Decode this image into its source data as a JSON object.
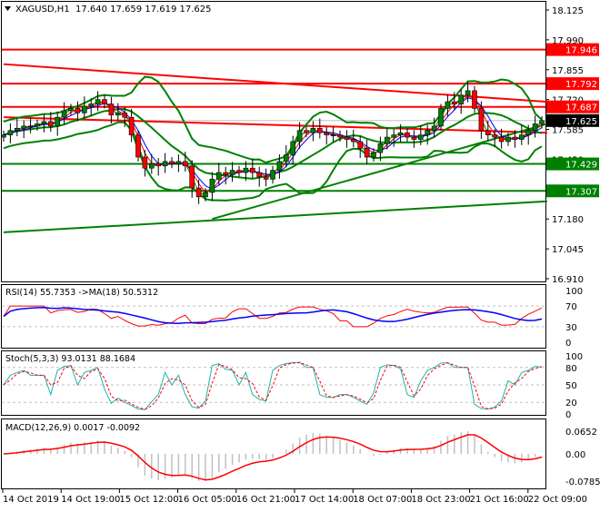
{
  "header": {
    "symbol": "XAGUSD,H1",
    "ohlc": "17.640 17.659 17.619 17.625"
  },
  "colors": {
    "bull": "#008000",
    "bear": "#ff0000",
    "resistance": "#ff0000",
    "support": "#008000",
    "ma_fast": "#0000ff",
    "rsi": "#ff0000",
    "rsi_ma": "#0000ff",
    "stoch_main": "#20b2aa",
    "stoch_signal": "#ff0000",
    "macd_hist": "#c0c0c0",
    "macd_signal": "#ff0000"
  },
  "chart_data": {
    "type": "candlestick",
    "title": "XAGUSD,H1",
    "close": [
      17.56,
      17.58,
      17.59,
      17.6,
      17.6,
      17.61,
      17.62,
      17.6,
      17.64,
      17.67,
      17.68,
      17.66,
      17.69,
      17.7,
      17.72,
      17.7,
      17.65,
      17.66,
      17.64,
      17.56,
      17.46,
      17.41,
      17.43,
      17.42,
      17.44,
      17.43,
      17.44,
      17.42,
      17.32,
      17.28,
      17.3,
      17.36,
      17.39,
      17.38,
      17.4,
      17.39,
      17.41,
      17.39,
      17.37,
      17.36,
      17.4,
      17.44,
      17.47,
      17.53,
      17.58,
      17.57,
      17.59,
      17.57,
      17.56,
      17.56,
      17.55,
      17.54,
      17.53,
      17.5,
      17.46,
      17.48,
      17.52,
      17.55,
      17.56,
      17.57,
      17.55,
      17.54,
      17.56,
      17.58,
      17.6,
      17.68,
      17.71,
      17.7,
      17.74,
      17.76,
      17.68,
      17.58,
      17.56,
      17.55,
      17.53,
      17.55,
      17.54,
      17.56,
      17.58,
      17.61,
      17.625
    ],
    "ylim": [
      16.91,
      18.125
    ],
    "price_ticks": [
      "18.125",
      "17.990",
      "17.855",
      "17.720",
      "17.585",
      "17.450",
      "17.315",
      "17.180",
      "17.045",
      "16.910"
    ],
    "current_price": "17.625",
    "levels": [
      {
        "value": "17.946",
        "type": "resistance"
      },
      {
        "value": "17.792",
        "type": "resistance"
      },
      {
        "value": "17.687",
        "type": "resistance"
      },
      {
        "value": "17.429",
        "type": "support"
      },
      {
        "value": "17.307",
        "type": "support"
      }
    ],
    "trendlines": [
      {
        "type": "resistance",
        "from": [
          0,
          17.88
        ],
        "to": [
          80,
          17.71
        ]
      },
      {
        "type": "resistance",
        "from": [
          0,
          17.64
        ],
        "to": [
          80,
          17.57
        ]
      },
      {
        "type": "support",
        "from": [
          31,
          17.18
        ],
        "to": [
          80,
          17.61
        ]
      },
      {
        "type": "support",
        "from": [
          0,
          17.12
        ],
        "to": [
          80,
          17.26
        ]
      }
    ],
    "time_labels": [
      "14 Oct 2019",
      "14 Oct 19:00",
      "15 Oct 12:00",
      "16 Oct 05:00",
      "16 Oct 21:00",
      "17 Oct 14:00",
      "18 Oct 07:00",
      "18 Oct 23:00",
      "21 Oct 16:00",
      "22 Oct 09:00"
    ],
    "rsi": {
      "label": "RSI(14) 55.7353  ->MA(18) 50.5312",
      "ticks": [
        "100",
        "70",
        "30",
        "0"
      ],
      "levels": [
        30,
        70
      ]
    },
    "stoch": {
      "label": "Stoch(5,3,3) 93.0131 88.1684",
      "ticks": [
        "100",
        "80",
        "50",
        "20",
        "0"
      ],
      "levels": [
        20,
        50,
        80
      ]
    },
    "macd": {
      "label": "MACD(12,26,9) 0.0017 -0.0092",
      "ticks": [
        "0.0652",
        "0.00",
        "-0.0785"
      ],
      "ylim": [
        -0.0785,
        0.0652
      ]
    }
  }
}
